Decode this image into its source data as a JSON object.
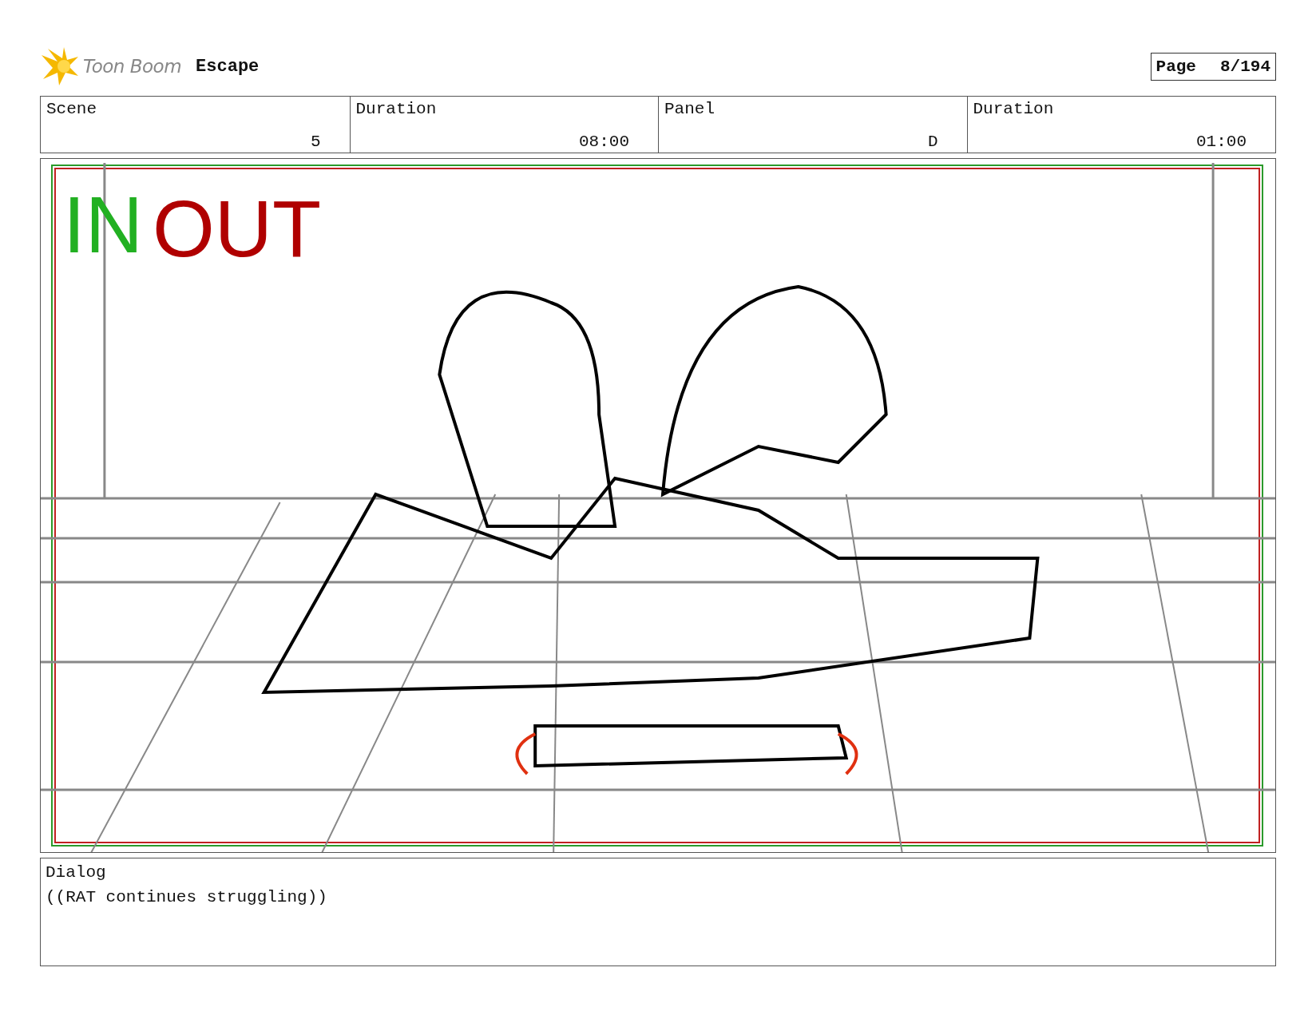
{
  "header": {
    "logo_text": "Toon Boom",
    "project": "Escape",
    "page_label": "Page",
    "page_number": "8/194"
  },
  "fields": [
    {
      "label": "Scene",
      "value": "5"
    },
    {
      "label": "Duration",
      "value": "08:00"
    },
    {
      "label": "Panel",
      "value": "D"
    },
    {
      "label": "Duration",
      "value": "01:00"
    }
  ],
  "panel": {
    "in_marker": "IN",
    "out_marker": "OUT"
  },
  "dialog": {
    "label": "Dialog",
    "text": "((RAT continues struggling))"
  }
}
